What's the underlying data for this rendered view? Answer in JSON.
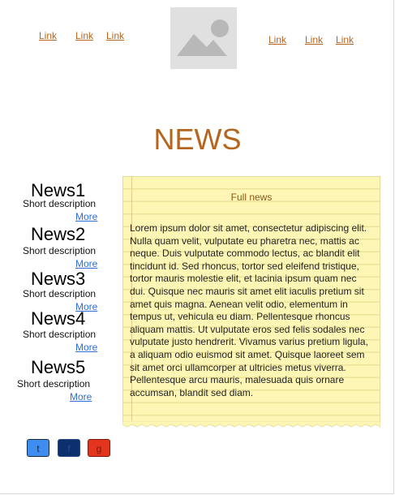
{
  "header": {
    "links_left": [
      "Link",
      "Link",
      "Link"
    ],
    "links_right": [
      "Link",
      "Link",
      "Link"
    ],
    "logo_icon": "image-placeholder-icon"
  },
  "main": {
    "title": "NEWS"
  },
  "news_items": [
    {
      "title": "News1",
      "description": "Short description",
      "more": "More"
    },
    {
      "title": "News2",
      "description": "Short description",
      "more": "More"
    },
    {
      "title": "News3",
      "description": "Short description",
      "more": "More"
    },
    {
      "title": "News4",
      "description": "Short description",
      "more": "More"
    },
    {
      "title": "News5",
      "description": "Short description",
      "more": "More"
    }
  ],
  "full_news": {
    "heading": "Full news",
    "body": "Lorem ipsum dolor sit amet, consectetur adipiscing elit. Nulla quam velit, vulputate eu pharetra nec, mattis ac neque. Duis vulputate commodo lectus, ac blandit elit tincidunt id. Sed rhoncus, tortor sed eleifend tristique, tortor mauris molestie elit, et lacinia ipsum quam nec dui. Quisque nec mauris sit amet elit iaculis pretium sit amet quis magna. Aenean velit odio, elementum in tempus ut, vehicula eu diam. Pellentesque rhoncus aliquam mattis. Ut vulputate eros sed felis sodales nec vulputate justo hendrerit. Vivamus varius pretium ligula, a aliquam odio euismod sit amet. Quisque laoreet sem sit amet orci ullamcorper at ultricies metus viverra. Pellentesque arcu mauris, malesuada quis ornare accumsan, blandit sed diam."
  },
  "social": [
    {
      "label": "t",
      "icon": "twitter-icon",
      "bg": "#3d8ef0",
      "fg": "#1d2a3a"
    },
    {
      "label": "f",
      "icon": "facebook-icon",
      "bg": "#0d2f6e",
      "fg": "#2a4a8a"
    },
    {
      "label": "g",
      "icon": "google-plus-icon",
      "bg": "#e3341e",
      "fg": "#7a1a10"
    }
  ],
  "colors": {
    "accent": "#b5651d",
    "link_blue": "#2f6fd6",
    "note_yellow": "#fdf6b4"
  }
}
